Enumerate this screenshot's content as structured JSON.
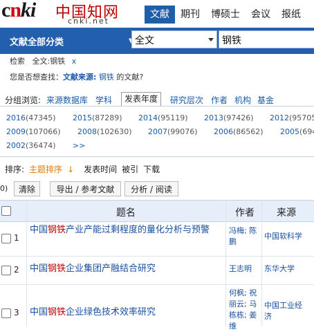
{
  "logo": {
    "brand": "cnki",
    "hanzi": "中国知网",
    "url": "cnki.net"
  },
  "nav": {
    "tabs": [
      "文献",
      "期刊",
      "博硕士",
      "会议",
      "报纸"
    ]
  },
  "search": {
    "category_label": "文献全部分类",
    "field": "全文",
    "query": "钢铁"
  },
  "breadcrumb": {
    "label": "检索",
    "filter": "全文:钢铁",
    "remove": "x"
  },
  "suggest": {
    "prefix": "您是否想查找：",
    "source_label": "文献来源:",
    "keyword": "钢铁",
    "suffix": "的文献?"
  },
  "grouping": {
    "label": "分组浏览:",
    "options": [
      "来源数据库",
      "学科",
      "发表年度",
      "研究层次",
      "作者",
      "机构",
      "基金"
    ]
  },
  "years": [
    {
      "year": "2016",
      "count": "(47345)"
    },
    {
      "year": "2015",
      "count": "(87289)"
    },
    {
      "year": "2014",
      "count": "(95119)"
    },
    {
      "year": "2013",
      "count": "(97426)"
    },
    {
      "year": "2012",
      "count": "(95705"
    },
    {
      "year": "2009",
      "count": "(107066)"
    },
    {
      "year": "2008",
      "count": "(102630)"
    },
    {
      "year": "2007",
      "count": "(99076)"
    },
    {
      "year": "2006",
      "count": "(86562)"
    },
    {
      "year": "2005",
      "count": "(694"
    },
    {
      "year": "2002",
      "count": "(36474)"
    }
  ],
  "years_more": ">>",
  "sort": {
    "label": "排序:",
    "active": "主题排序",
    "arrow": "↓",
    "options": [
      "发表时间",
      "被引",
      "下载"
    ]
  },
  "toolbar": {
    "count_prefix": "0)",
    "clear": "清除",
    "export": "导出 / 参考文献",
    "analyze": "分析 / 阅读"
  },
  "table": {
    "headers": {
      "title": "题名",
      "author": "作者",
      "source": "来源"
    },
    "rows": [
      {
        "num": "1",
        "t_pre": "中国",
        "t_hl": "钢铁",
        "t_post": "产业产能过剩程度的量化分析与预警",
        "author": "冯梅; 陈鹏",
        "source": "中国软科学"
      },
      {
        "num": "2",
        "t_pre": "中国",
        "t_hl": "钢铁",
        "t_post": "企业集团产融结合研究",
        "author": "王志明",
        "source": "东华大学"
      },
      {
        "num": "3",
        "t_pre": "中国",
        "t_hl": "钢铁",
        "t_post": "企业绿色技术效率研究",
        "author": "何枫; 祝丽云; 马栋栋; 姜维",
        "source": "中国工业经济"
      }
    ]
  },
  "colors": {
    "brand_blue": "#2260ad",
    "highlight_red": "#c00000",
    "link_blue": "#1a5aa8"
  }
}
